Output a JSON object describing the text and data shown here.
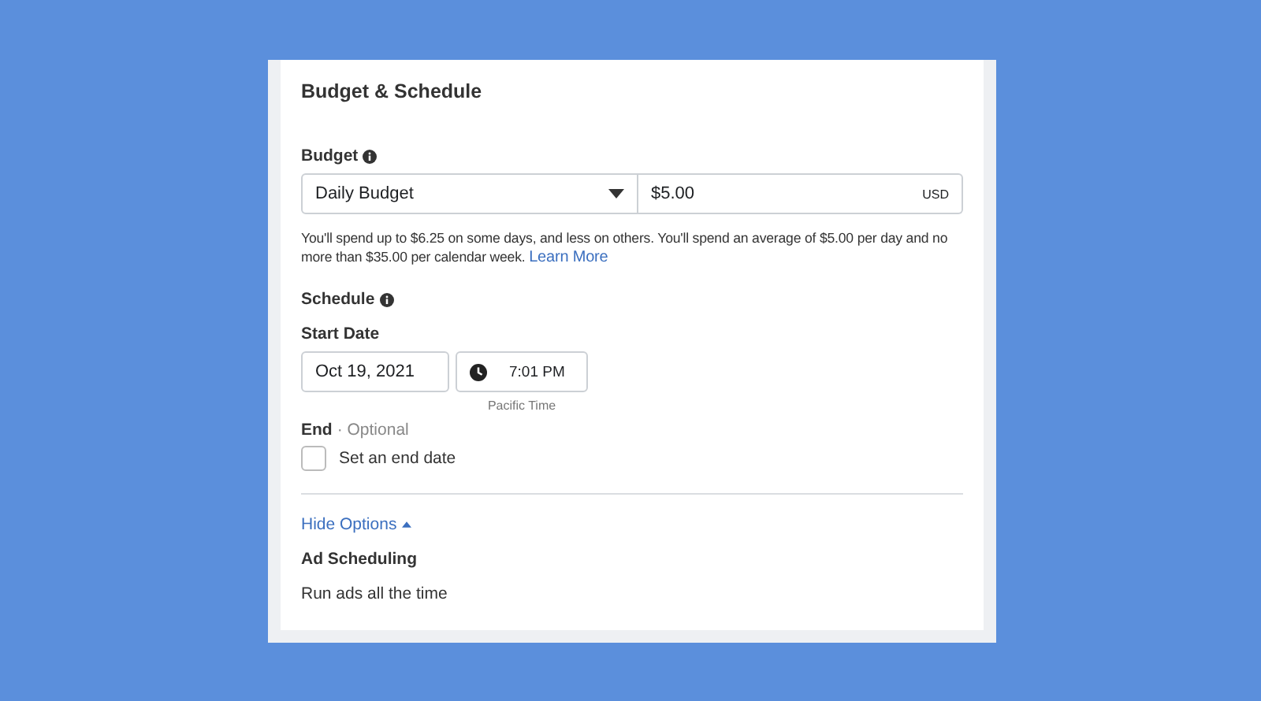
{
  "section": {
    "title": "Budget & Schedule"
  },
  "budget": {
    "label": "Budget",
    "type": "Daily Budget",
    "amount": "$5.00",
    "currency": "USD",
    "help": "You'll spend up to $6.25 on some days, and less on others. You'll spend an average of $5.00 per day and no more than $35.00 per calendar week.",
    "link": "Learn More"
  },
  "schedule": {
    "label": "Schedule",
    "start_label": "Start Date",
    "date": "Oct 19, 2021",
    "time": "7:01 PM",
    "timezone": "Pacific Time",
    "end_label": "End",
    "end_hint": "· Optional",
    "end_checkbox": {
      "label": "Set an end date",
      "checked": false
    }
  },
  "options": {
    "toggle": "Hide Options",
    "heading": "Ad Scheduling",
    "value": "Run ads all the time"
  }
}
